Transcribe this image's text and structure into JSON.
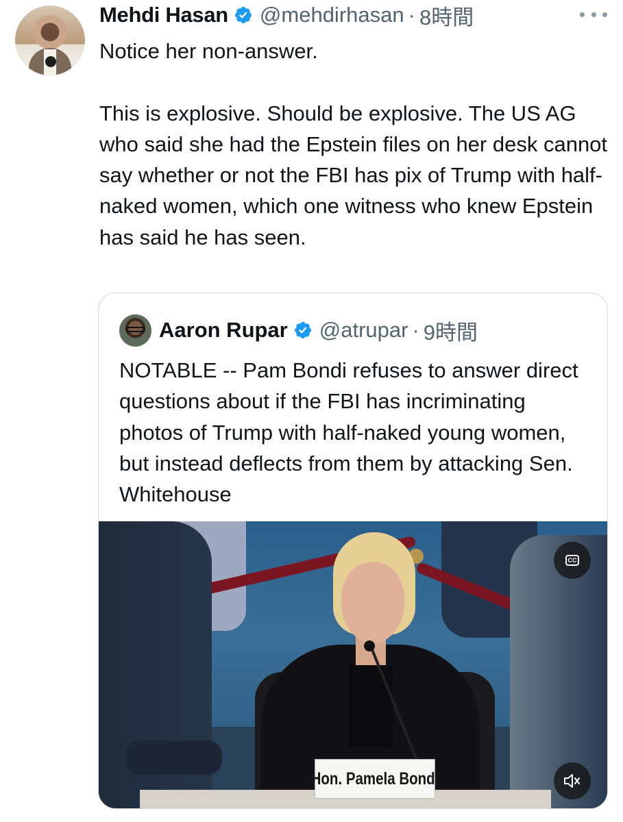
{
  "tweet": {
    "author_name": "Mehdi Hasan",
    "handle": "@mehdirhasan",
    "separator": "·",
    "time": "8時間",
    "text": "Notice her non-answer.\n\nThis is explosive. Should be explosive. The US AG who said she had the Epstein files on her desk cannot say whether or not the FBI has pix of Trump with half-naked women, which one witness who knew Epstein has said he has seen."
  },
  "quoted_tweet": {
    "author_name": "Aaron Rupar",
    "handle": "@atrupar",
    "separator": "·",
    "time": "9時間",
    "text": "NOTABLE -- Pam Bondi refuses to answer direct questions about if the FBI has incriminating photos of Trump with half-naked young women, but instead deflects from them by attacking Sen. Whitehouse",
    "video": {
      "nameplate": "Hon. Pamela Bondi",
      "cc_label": "CC"
    }
  },
  "colors": {
    "verified": "#1d9bf0",
    "secondary_text": "#536471",
    "border": "#cfd9de"
  },
  "icons": {
    "verified": "verified-badge-icon",
    "more": "more-options-icon",
    "captions": "closed-captions-icon",
    "mute": "muted-speaker-icon"
  }
}
